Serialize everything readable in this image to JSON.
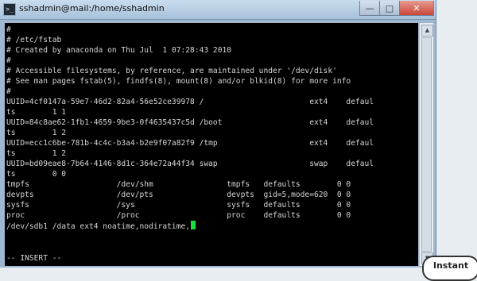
{
  "window": {
    "title": "sshadmin@mail:/home/sshadmin",
    "controls": {
      "minimize": "—",
      "maximize": "□",
      "close": "✕"
    }
  },
  "terminal": {
    "lines": [
      "#",
      "# /etc/fstab",
      "# Created by anaconda on Thu Jul  1 07:28:43 2010",
      "#",
      "# Accessible filesystems, by reference, are maintained under '/dev/disk'",
      "# See man pages fstab(5), findfs(8), mount(8) and/or blkid(8) for more info",
      "#",
      "UUID=4cf0147a-59e7-46d2-82a4-56e52ce39978 /                       ext4    defaul",
      "ts        1 1",
      "UUID=84c8ae62-1fb1-4659-9be3-0f4635437c5d /boot                   ext4    defaul",
      "ts        1 2",
      "UUID=ecc1c6be-781b-4c4c-b3a4-b2e9f07a82f9 /tmp                    ext4    defaul",
      "ts        1 2",
      "UUID=bd09eae8-7b64-4146-8d1c-364e72a44f34 swap                    swap    defaul",
      "ts        0 0",
      "tmpfs                   /dev/shm                tmpfs   defaults        0 0",
      "devpts                  /dev/pts                devpts  gid=5,mode=620  0 0",
      "sysfs                   /sys                    sysfs   defaults        0 0",
      "proc                    /proc                   proc    defaults        0 0",
      "/dev/sdb1 /data ext4 noatime,nodiratime,"
    ],
    "mode_line": "-- INSERT --",
    "accent_colors": {
      "cursor": "#18e33b",
      "background": "#000000",
      "text": "#d6d6d6"
    }
  },
  "overlay": {
    "badge_text": "Instant"
  },
  "icons": {
    "app": "terminal-icon",
    "scroll_up": "arrow-up-icon",
    "scroll_down": "arrow-down-icon"
  }
}
